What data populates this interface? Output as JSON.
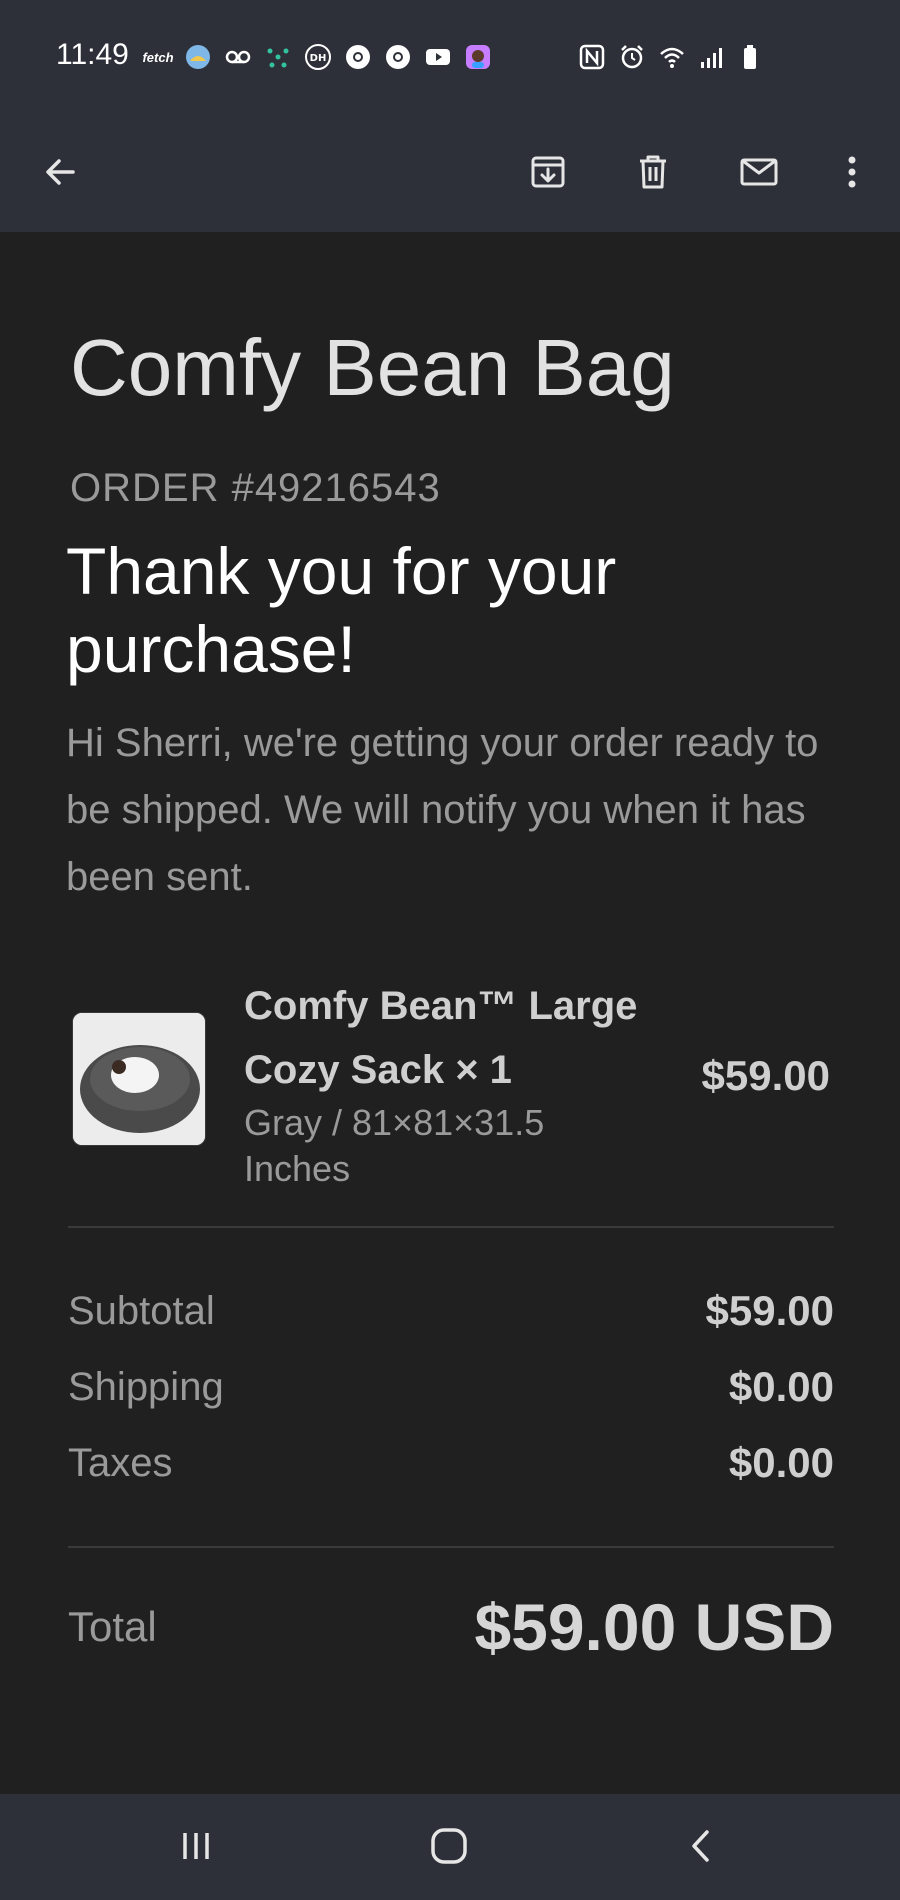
{
  "status_bar": {
    "time": "11:49",
    "fetch_label": "fetch",
    "left_icons": [
      "fetch-app-icon",
      "game-app-icon",
      "voicemail-icon",
      "dots-app-icon",
      "dh-app-icon",
      "chrome-icon",
      "chrome-icon",
      "youtube-icon",
      "avatar-app-icon"
    ],
    "right_icons": [
      "nfc-icon",
      "alarm-icon",
      "wifi-icon",
      "signal-icon",
      "battery-icon"
    ]
  },
  "app_bar": {
    "actions": [
      "back-arrow-icon",
      "archive-icon",
      "delete-icon",
      "mark-unread-icon",
      "more-options-icon"
    ]
  },
  "email": {
    "store_title": "Comfy Bean Bag",
    "order_number": "ORDER #49216543",
    "thank_you": "Thank you for your purchase!",
    "message": "Hi Sherri, we're getting your order ready to be shipped. We will notify you when it has been sent.",
    "product": {
      "name": "Comfy Bean™ Large Cozy Sack × 1",
      "variant": "Gray / 81×81×31.5 Inches",
      "price": "$59.00"
    },
    "summary": {
      "subtotal_label": "Subtotal",
      "subtotal_value": "$59.00",
      "shipping_label": "Shipping",
      "shipping_value": "$0.00",
      "taxes_label": "Taxes",
      "taxes_value": "$0.00"
    },
    "total": {
      "label": "Total",
      "value": "$59.00 USD"
    }
  },
  "nav_bar": {
    "buttons": [
      "recent-apps-icon",
      "home-icon",
      "back-icon"
    ]
  },
  "colors": {
    "bar_background": "#2d3038",
    "content_background": "#202020",
    "primary_text": "#ffffff",
    "secondary_text": "#9a9a9a"
  }
}
